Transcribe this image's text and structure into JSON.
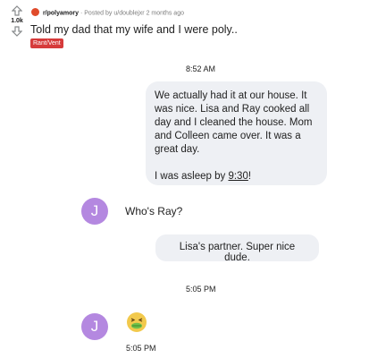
{
  "post": {
    "score": "1.0k",
    "subreddit": "r/polyamory",
    "posted_by_prefix": "· Posted by",
    "username": "u/doublejxr",
    "time_ago": "2 months ago",
    "title": "Told my dad that my wife and I were poly..",
    "flair": "Rant/Vent"
  },
  "chat": {
    "timestamp_1": "8:52 AM",
    "my_message_1": {
      "paragraph_1": "We actually had it at our house. It was nice. Lisa and Ray cooked all day and I cleaned the house. Mom and Colleen came over. It was a great day.",
      "paragraph_2_before": "I was asleep by ",
      "paragraph_2_link": "9:30",
      "paragraph_2_after": "!"
    },
    "contact_initial": "J",
    "their_message_1": "Who's Ray?",
    "my_message_2": "Lisa's partner. Super nice dude.",
    "timestamp_2": "5:05 PM",
    "emoji_icon": "nauseated-face-emoji",
    "emoji_time": "5:05 PM"
  }
}
